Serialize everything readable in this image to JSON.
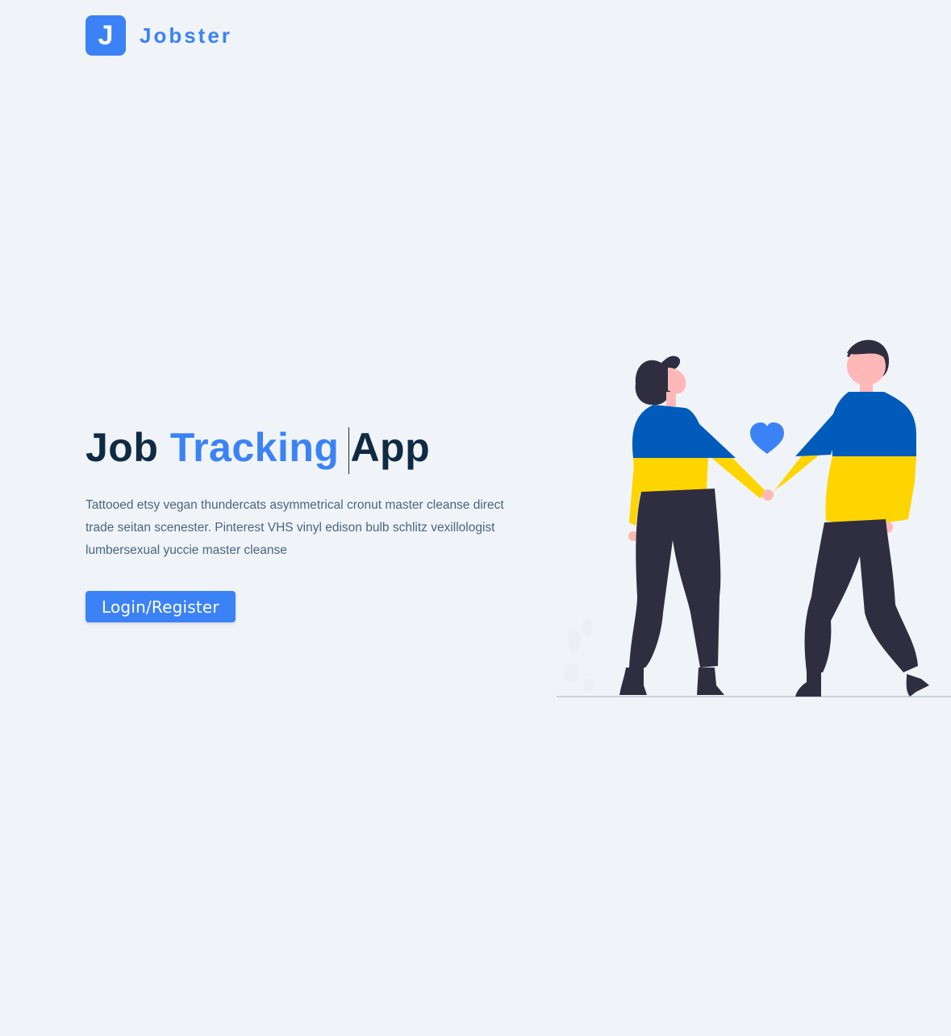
{
  "brand": {
    "logo_letter": "J",
    "name": "Jobster"
  },
  "hero": {
    "title_part1": "Job",
    "title_accent": "Tracking",
    "title_part2": "App",
    "description": "Tattooed etsy vegan thundercats asymmetrical cronut master cleanse direct trade seitan scenester. Pinterest VHS vinyl edison bulb schlitz vexillologist lumbersexual yuccie master cleanse",
    "cta_label": "Login/Register"
  },
  "colors": {
    "primary": "#3b82f6",
    "heading": "#102a43",
    "background": "#f0f4f8",
    "blue_sweater": "#005bbb",
    "yellow_sweater": "#ffd500"
  },
  "icons": {
    "illustration": "couple-holding-hands-illustration",
    "heart": "heart-icon"
  }
}
